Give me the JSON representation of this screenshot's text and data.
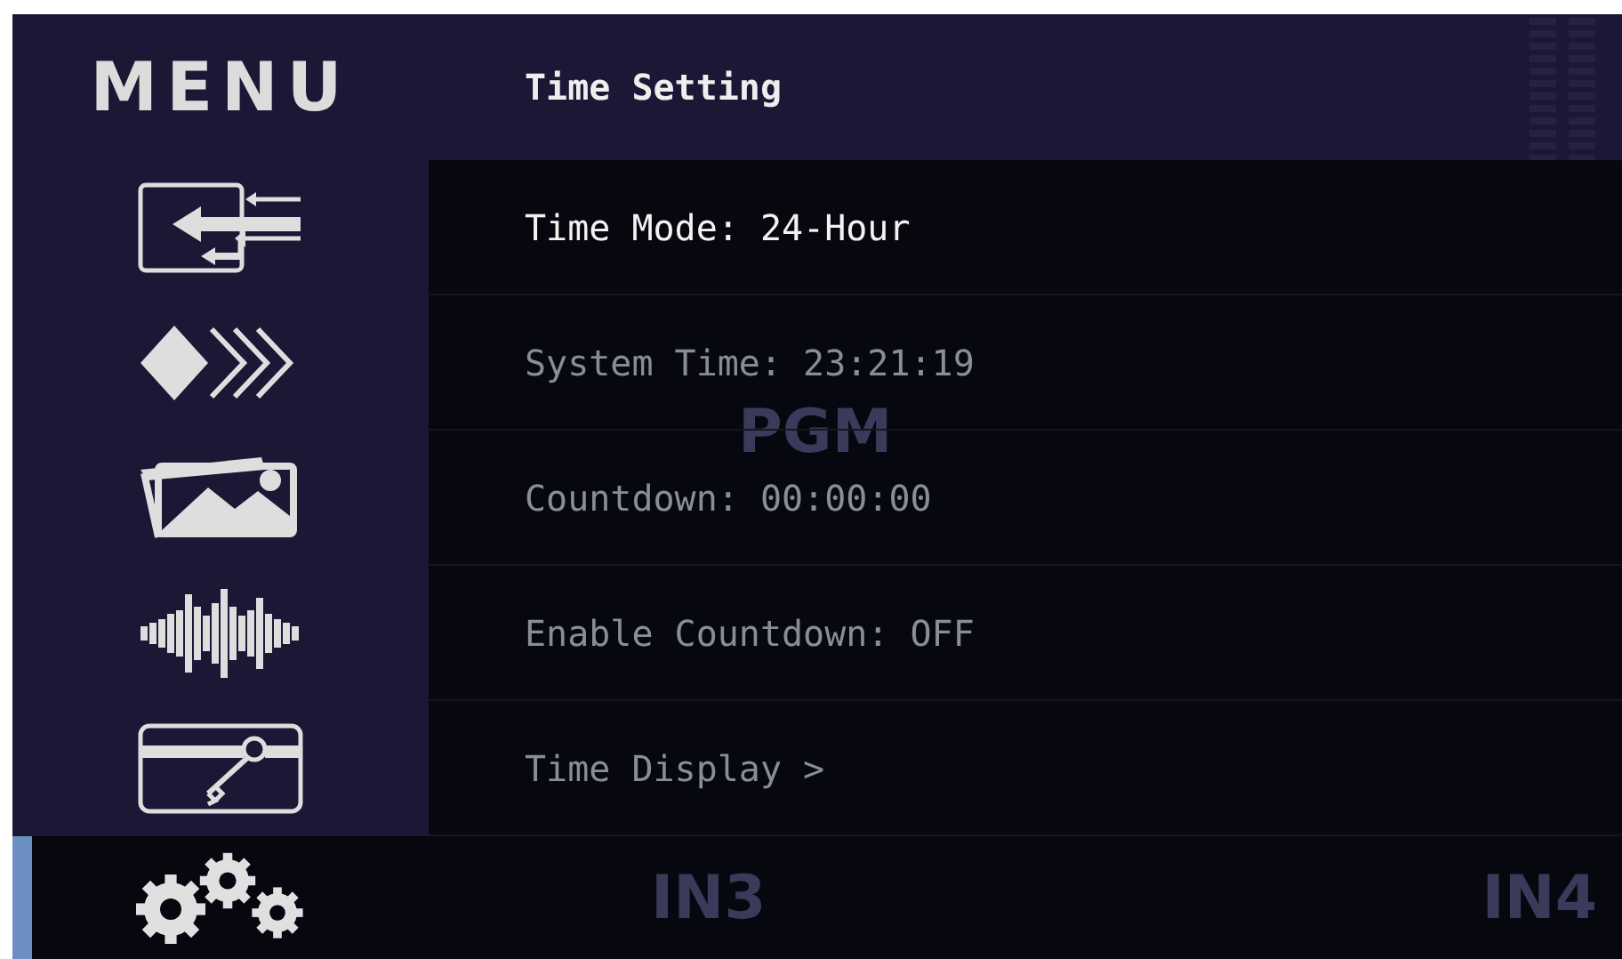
{
  "sidebar": {
    "title": "MENU",
    "items": [
      {
        "kind": "input",
        "selected": false
      },
      {
        "kind": "transition",
        "selected": false
      },
      {
        "kind": "picture",
        "selected": false
      },
      {
        "kind": "audio",
        "selected": false
      },
      {
        "kind": "key",
        "selected": false
      },
      {
        "kind": "settings",
        "selected": true
      }
    ]
  },
  "panel": {
    "title": "Time Setting",
    "rows": [
      {
        "label": "Time Mode: 24-Hour",
        "selected": true
      },
      {
        "label": "System Time: 23:21:19",
        "selected": false
      },
      {
        "label": "Countdown: 00:00:00",
        "selected": false
      },
      {
        "label": "Enable Countdown: OFF",
        "selected": false
      },
      {
        "label": "Time Display >",
        "selected": false
      }
    ]
  },
  "background_labels": [
    "PGM",
    "IN3",
    "IN4"
  ]
}
